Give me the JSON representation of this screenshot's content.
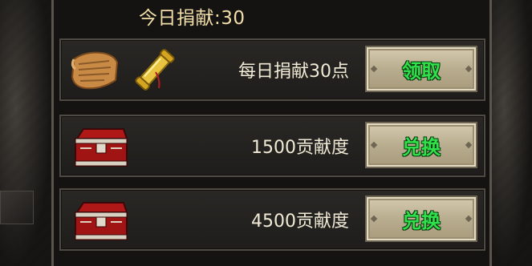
{
  "header": {
    "title": "今日捐献:30"
  },
  "rows": [
    {
      "label": "每日捐献30点",
      "button": "领取",
      "icons": [
        "scroll-icon",
        "rolled-scroll-icon"
      ]
    },
    {
      "label": "1500贡献度",
      "button": "兑换",
      "icons": [
        "treasure-chest-icon"
      ]
    },
    {
      "label": "4500贡献度",
      "button": "兑换",
      "icons": [
        "treasure-chest-icon"
      ]
    }
  ],
  "colors": {
    "header_text": "#f2dfaa",
    "button_text": "#2fe04a",
    "label_text": "#f1ead6"
  }
}
